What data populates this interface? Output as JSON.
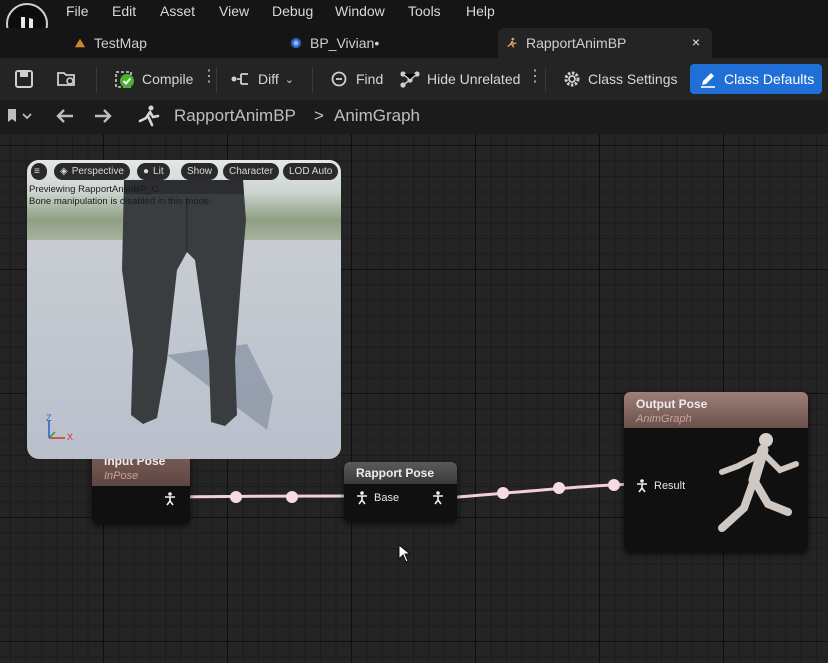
{
  "menu": [
    "File",
    "Edit",
    "Asset",
    "View",
    "Debug",
    "Window",
    "Tools",
    "Help"
  ],
  "tabs": [
    {
      "label": "TestMap",
      "icon": "level-icon"
    },
    {
      "label": "BP_Vivian•",
      "icon": "blueprint-icon"
    },
    {
      "label": "RapportAnimBP",
      "icon": "anim-blueprint-icon",
      "close": "×"
    }
  ],
  "toolbar": {
    "compile": "Compile",
    "diff": "Diff",
    "find": "Find",
    "hide_unrelated": "Hide Unrelated",
    "class_settings": "Class Settings",
    "class_defaults": "Class Defaults"
  },
  "breadcrumb": {
    "root": "RapportAnimBP",
    "separator": ">",
    "current": "AnimGraph"
  },
  "viewport": {
    "buttons": {
      "perspective": "Perspective",
      "lit": "Lit",
      "show": "Show",
      "character": "Character",
      "lod": "LOD Auto"
    },
    "info_line1": "Previewing RapportAnimBP_C.",
    "info_line2": "Bone manipulation is disabled in this mode.",
    "axis_z": "Z",
    "axis_x": "X"
  },
  "nodes": {
    "input_pose": {
      "title": "Input Pose",
      "subtitle": "InPose"
    },
    "rapport_pose": {
      "title": "Rapport Pose",
      "pin_in": "Base"
    },
    "output_pose": {
      "title": "Output Pose",
      "subtitle": "AnimGraph",
      "pin_in": "Result"
    }
  },
  "colors": {
    "accent": "#1f6fd6",
    "wire": "#f3cfd8",
    "node_header": "#7a5e58"
  }
}
